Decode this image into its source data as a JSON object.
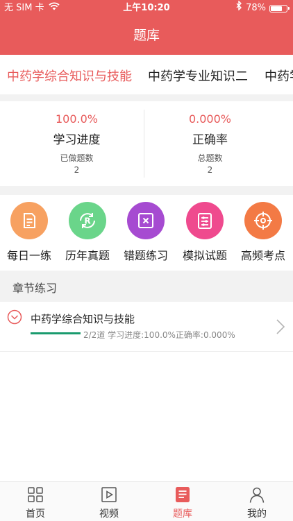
{
  "status_bar": {
    "carrier": "无 SIM 卡",
    "time": "上午10:20",
    "battery": "78%",
    "battery_level": 0.78
  },
  "page_title": "题库",
  "subject_tabs": [
    {
      "label": "中药学综合知识与技能",
      "active": true
    },
    {
      "label": "中药学专业知识二",
      "active": false
    },
    {
      "label": "中药学",
      "active": false
    }
  ],
  "stats": {
    "progress": {
      "value": "100.0%",
      "label": "学习进度",
      "sub_label": "已做题数",
      "count": "2"
    },
    "accuracy": {
      "value": "0.000%",
      "label": "正确率",
      "sub_label": "总题数",
      "count": "2"
    }
  },
  "quick_actions": [
    {
      "label": "每日一练",
      "icon": "daily-practice-icon",
      "color": "#f7a161"
    },
    {
      "label": "历年真题",
      "icon": "past-exams-icon",
      "color": "#6ad58a"
    },
    {
      "label": "错题练习",
      "icon": "wrong-questions-icon",
      "color": "#a64bd1"
    },
    {
      "label": "模拟试题",
      "icon": "mock-exam-icon",
      "color": "#ef4a8e"
    },
    {
      "label": "高频考点",
      "icon": "hot-points-icon",
      "color": "#f37a45"
    }
  ],
  "chapter_section": {
    "title": "章节练习",
    "items": [
      {
        "name": "中药学综合知识与技能",
        "meta": "2/2道 学习进度:100.0%正确率:0.000%",
        "progress": 1.0
      }
    ]
  },
  "tab_bar": [
    {
      "label": "首页",
      "icon": "home-grid-icon",
      "active": false
    },
    {
      "label": "视频",
      "icon": "video-icon",
      "active": false
    },
    {
      "label": "题库",
      "icon": "question-bank-icon",
      "active": true
    },
    {
      "label": "我的",
      "icon": "profile-icon",
      "active": false
    }
  ],
  "colors": {
    "accent": "#e85b5b",
    "progress": "#1a9b6e"
  }
}
